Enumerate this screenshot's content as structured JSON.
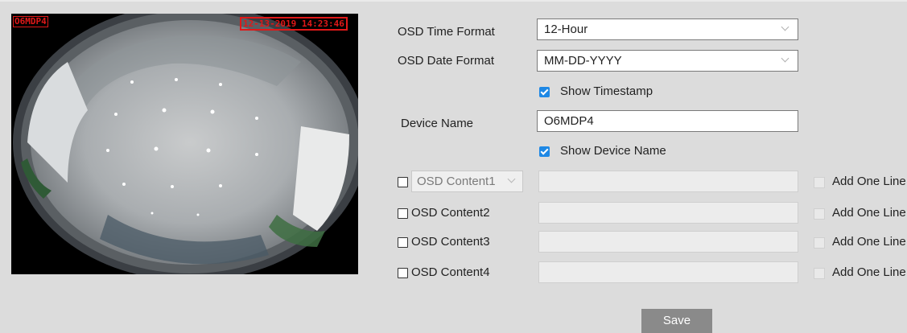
{
  "preview": {
    "osd_name": "O6MDP4",
    "osd_time": "12-13-2019 14:23:46"
  },
  "form": {
    "time_format_label": "OSD Time Format",
    "time_format_value": "12-Hour",
    "date_format_label": "OSD Date Format",
    "date_format_value": "MM-DD-YYYY",
    "show_timestamp_label": "Show Timestamp",
    "device_name_label": "Device Name",
    "device_name_value": "O6MDP4",
    "show_device_name_label": "Show Device Name",
    "osd_content1_select": "OSD Content1",
    "osd_content2_label": "OSD Content2",
    "osd_content3_label": "OSD Content3",
    "osd_content4_label": "OSD Content4",
    "add_one_line_label": "Add One Line",
    "save_label": "Save"
  },
  "colors": {
    "page_bg": "#dcdcdc",
    "osd_text": "#e01818",
    "checkbox_checked": "#1e88e5",
    "save_button": "#8a8a8a"
  }
}
